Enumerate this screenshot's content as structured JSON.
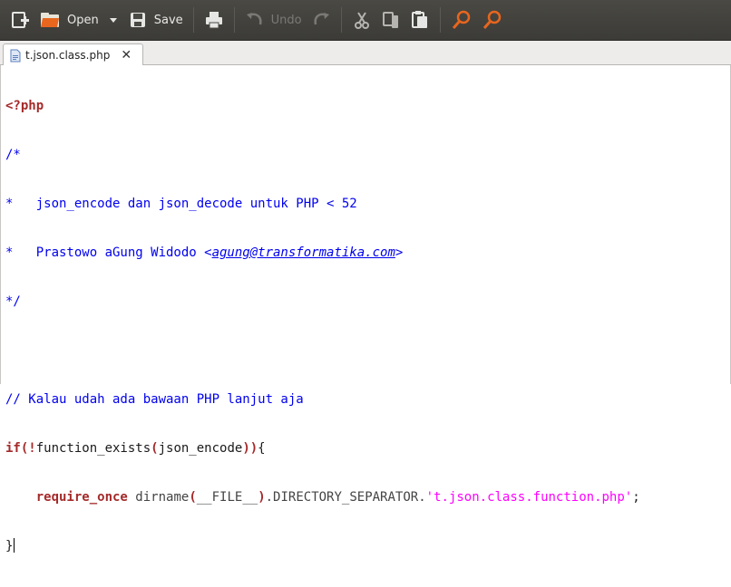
{
  "toolbar": {
    "open_label": "Open",
    "save_label": "Save",
    "undo_label": "Undo",
    "icons": [
      "new-document-icon",
      "open-folder-icon",
      "dropdown-arrow-icon",
      "save-icon",
      "print-icon",
      "undo-icon",
      "redo-icon",
      "cut-icon",
      "copy-icon",
      "paste-icon",
      "find-icon",
      "find-replace-icon"
    ]
  },
  "tab": {
    "filename": "t.json.class.php",
    "close_glyph": "✕"
  },
  "code": {
    "line1_open": "<?php",
    "line2": "/*",
    "line3": "*   json_encode dan json_decode untuk PHP < 52",
    "line4_prefix": "*   Prastowo aGung Widodo <",
    "line4_email": "agung@transformatika.com",
    "line4_suffix": ">",
    "line5": "*/",
    "line6": "",
    "line7": "// Kalau udah ada bawaan PHP lanjut aja",
    "line8_if": "if",
    "line8_open": "(!",
    "line8_fn": "function_exists",
    "line8_p1": "(",
    "line8_arg": "json_encode",
    "line8_p2": "))",
    "line8_brace": "{",
    "line9_indent": "    ",
    "line9_kw": "require_once",
    "line9_fn": " dirname",
    "line9_p1": "(",
    "line9_const": "__FILE__",
    "line9_p2": ")",
    "line9_mid": ".DIRECTORY_SEPARATOR.",
    "line9_str": "'t.json.class.function.php'",
    "line9_end": ";",
    "line10": "}"
  },
  "colors": {
    "toolbar_bg": "#3c3b37",
    "keyword": "#a52a2a",
    "comment": "#0000ee",
    "string": "#ff00ff",
    "accent_orange": "#e8661e"
  }
}
